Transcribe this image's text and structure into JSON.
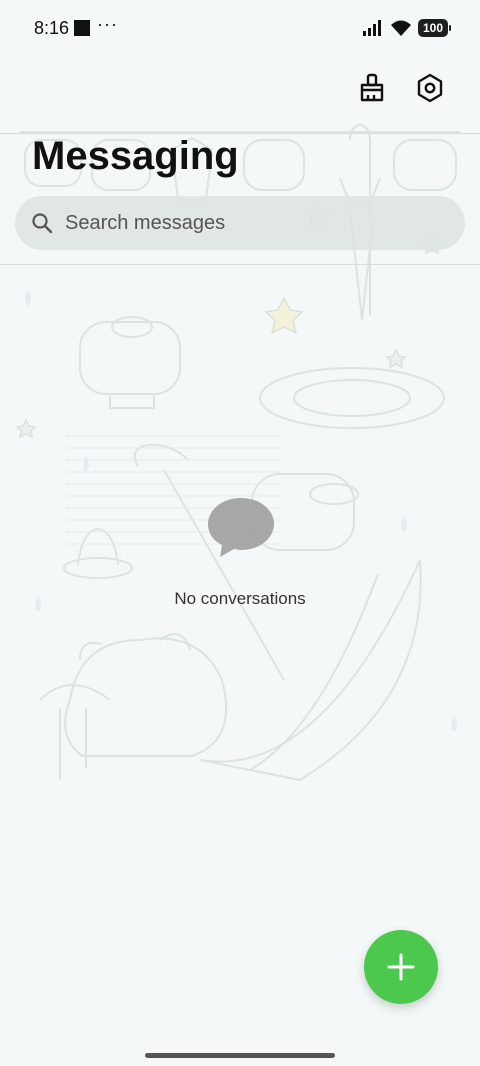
{
  "status_bar": {
    "time": "8:16",
    "dots": "···",
    "battery": "100"
  },
  "header": {
    "title": "Messaging",
    "clean_icon": "broom-icon",
    "settings_icon": "gear-hexagon-icon"
  },
  "search": {
    "placeholder": "Search messages"
  },
  "empty_state": {
    "icon": "chat-bubble-icon",
    "text": "No conversations"
  },
  "fab": {
    "icon": "plus-icon",
    "color": "#4cc94c"
  },
  "theme": {
    "background": "#f4f8f8",
    "accent": "#4cc94c"
  }
}
